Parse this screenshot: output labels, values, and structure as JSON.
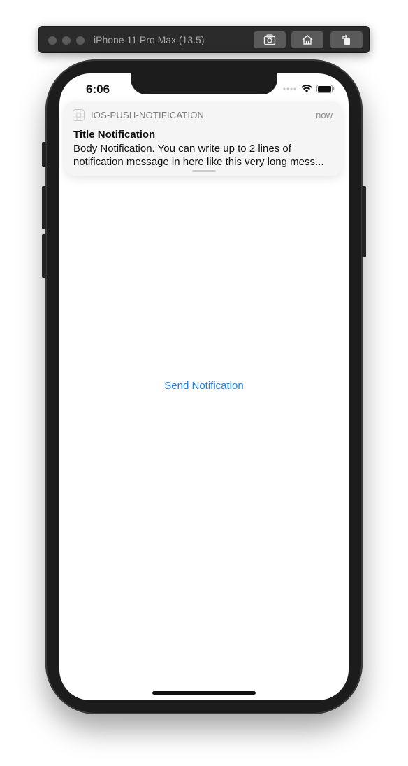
{
  "simulator": {
    "title": "iPhone 11 Pro Max (13.5)",
    "buttons": [
      "screenshot-icon",
      "home-icon",
      "rotate-icon"
    ]
  },
  "status_bar": {
    "time": "6:06",
    "icons": [
      "signal-icon",
      "wifi-icon",
      "battery-icon"
    ]
  },
  "notification": {
    "app_name": "IOS-PUSH-NOTIFICATION",
    "time": "now",
    "title": "Title Notification",
    "body_line1": "Body Notification. You can write up to 2 lines of",
    "body_line2": "notification message in here like this very long mess..."
  },
  "main": {
    "send_button_label": "Send Notification"
  },
  "colors": {
    "accent": "#1a7ff5",
    "phone_frame": "#1c1c1c"
  }
}
